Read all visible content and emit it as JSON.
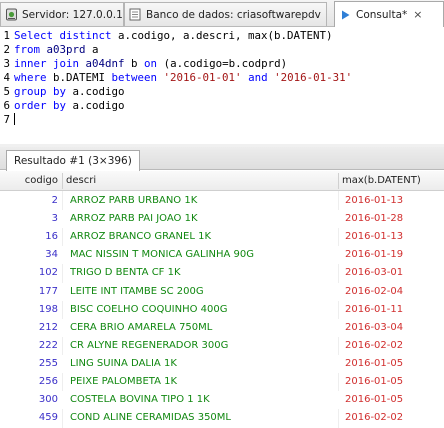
{
  "tabs": [
    {
      "label": "Servidor: 127.0.0.1",
      "icon": "server-icon",
      "active": false
    },
    {
      "label": "Banco de dados: criasoftwarepdv",
      "icon": "database-icon",
      "active": false
    },
    {
      "label": "Consulta*",
      "icon": "query-play-icon",
      "active": true
    }
  ],
  "editor": {
    "line_numbers": [
      "1",
      "2",
      "3",
      "4",
      "5",
      "6",
      "7"
    ],
    "l1": {
      "kw1": "Select distinct",
      "rest": " a.codigo, a.descri, max(b.DATENT)"
    },
    "l2": {
      "kw1": "from",
      "tbl": " a03prd",
      "rest": " a"
    },
    "l3": {
      "kw1": "inner join",
      "tbl": " a04dnf",
      "rest": " b ",
      "kw2": "on",
      "rest2": " (a.codigo=b.codprd)"
    },
    "l4": {
      "kw1": "where",
      "rest": " b.DATEMI ",
      "kw2": "between",
      "str1": " '2016-01-01'",
      "kw3": " and",
      "str2": " '2016-01-31'"
    },
    "l5": {
      "kw1": "group by",
      "rest": " a.codigo"
    },
    "l6": {
      "kw1": "order by",
      "rest": " a.codigo"
    }
  },
  "result_tab": {
    "label": "Resultado #1 (3×396)",
    "icon": "table-icon"
  },
  "grid": {
    "columns": [
      "codigo",
      "descri",
      "max(b.DATENT)"
    ],
    "rows": [
      [
        "2",
        "ARROZ PARB URBANO 1K",
        "2016-01-13"
      ],
      [
        "3",
        "ARROZ PARB PAI JOAO 1K",
        "2016-01-28"
      ],
      [
        "16",
        "ARROZ BRANCO GRANEL 1K",
        "2016-01-13"
      ],
      [
        "34",
        "MAC NISSIN T MONICA GALINHA 90G",
        "2016-01-19"
      ],
      [
        "102",
        "TRIGO D BENTA CF 1K",
        "2016-03-01"
      ],
      [
        "177",
        "LEITE INT ITAMBE SC 200G",
        "2016-02-04"
      ],
      [
        "198",
        "BISC COELHO COQUINHO 400G",
        "2016-01-11"
      ],
      [
        "212",
        "CERA BRIO AMARELA 750ML",
        "2016-03-04"
      ],
      [
        "222",
        "CR ALYNE REGENERADOR 300G",
        "2016-02-02"
      ],
      [
        "255",
        "LING SUINA DALIA 1K",
        "2016-01-05"
      ],
      [
        "256",
        "PEIXE PALOMBETA 1K",
        "2016-01-05"
      ],
      [
        "300",
        "COSTELA BOVINA TIPO 1 1K",
        "2016-01-05"
      ],
      [
        "459",
        "COND ALINE CERAMIDAS 350ML",
        "2016-02-02"
      ]
    ]
  },
  "colors": {
    "codigo": "#3a2fc8",
    "descri": "#118811",
    "date": "#d12f2f",
    "keyword": "#0000ff"
  }
}
